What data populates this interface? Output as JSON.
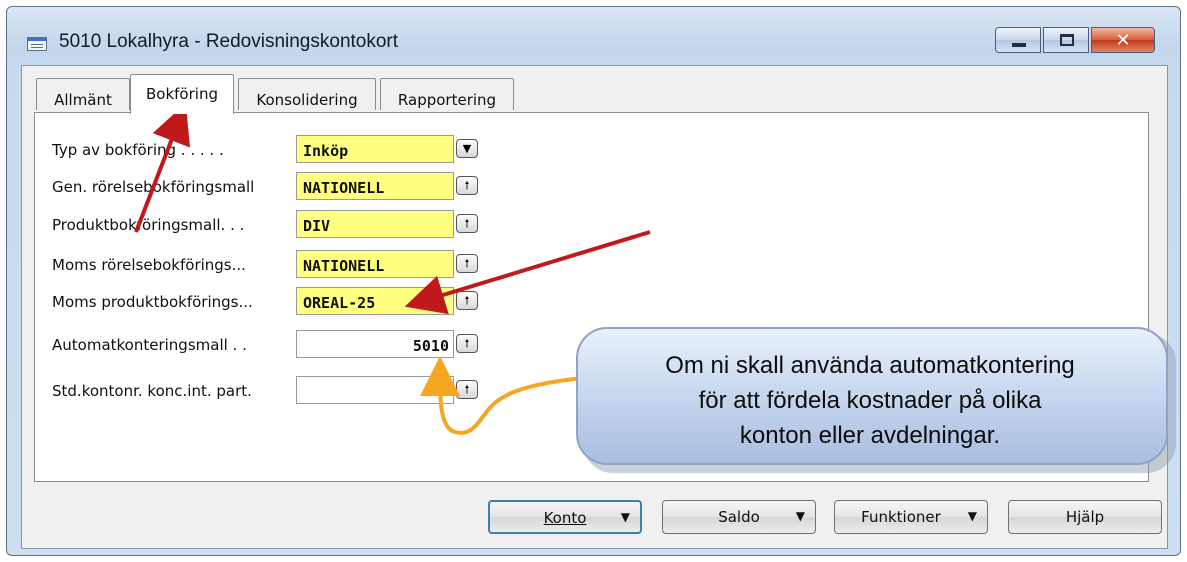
{
  "window": {
    "title": "5010 Lokalhyra - Redovisningskontokort",
    "close_glyph": "✕"
  },
  "tabs": [
    {
      "label": "Allmänt"
    },
    {
      "label": "Bokföring"
    },
    {
      "label": "Konsolidering"
    },
    {
      "label": "Rapportering"
    }
  ],
  "fields": [
    {
      "label": "Typ av bokföring . . . . .",
      "value": "Inköp",
      "button_icon": "dropdown-arrow-icon",
      "button_glyph": "▼"
    },
    {
      "label": "Gen. rörelsebokföringsmall",
      "value": "NATIONELL",
      "button_icon": "lookup-arrow-icon",
      "button_glyph": "🠕"
    },
    {
      "label": "Produktbokföringsmall. . .",
      "value": "DIV",
      "button_icon": "lookup-arrow-icon",
      "button_glyph": "🠕"
    },
    {
      "label": "Moms rörelsebokförings...",
      "value": "NATIONELL",
      "button_icon": "lookup-arrow-icon",
      "button_glyph": "🠕"
    },
    {
      "label": "Moms produktbokförings...",
      "value": "OREAL-25",
      "button_icon": "lookup-arrow-icon",
      "button_glyph": "🠕"
    },
    {
      "label": "Automatkonteringsmall . .",
      "value": "5010",
      "button_icon": "lookup-arrow-icon",
      "button_glyph": "🠕"
    },
    {
      "label": "Std.kontonr. konc.int. part.",
      "value": "",
      "button_icon": "lookup-arrow-icon",
      "button_glyph": "🠕"
    }
  ],
  "buttons": [
    {
      "label": "Konto",
      "caret": "▼"
    },
    {
      "label": "Saldo",
      "caret": "▼"
    },
    {
      "label": "Funktioner",
      "caret": "▼"
    },
    {
      "label": "Hjälp"
    }
  ],
  "callout": {
    "lines": [
      "Om ni skall använda automatkontering",
      "för att fördela kostnader på olika",
      "konton eller avdelningar."
    ]
  },
  "colors": {
    "field_highlight": "#ffff80",
    "annotation_arrow_red": "#c0191c",
    "annotation_arrow_orange": "#f5a623",
    "callout_fill": "#c9d9ef"
  }
}
